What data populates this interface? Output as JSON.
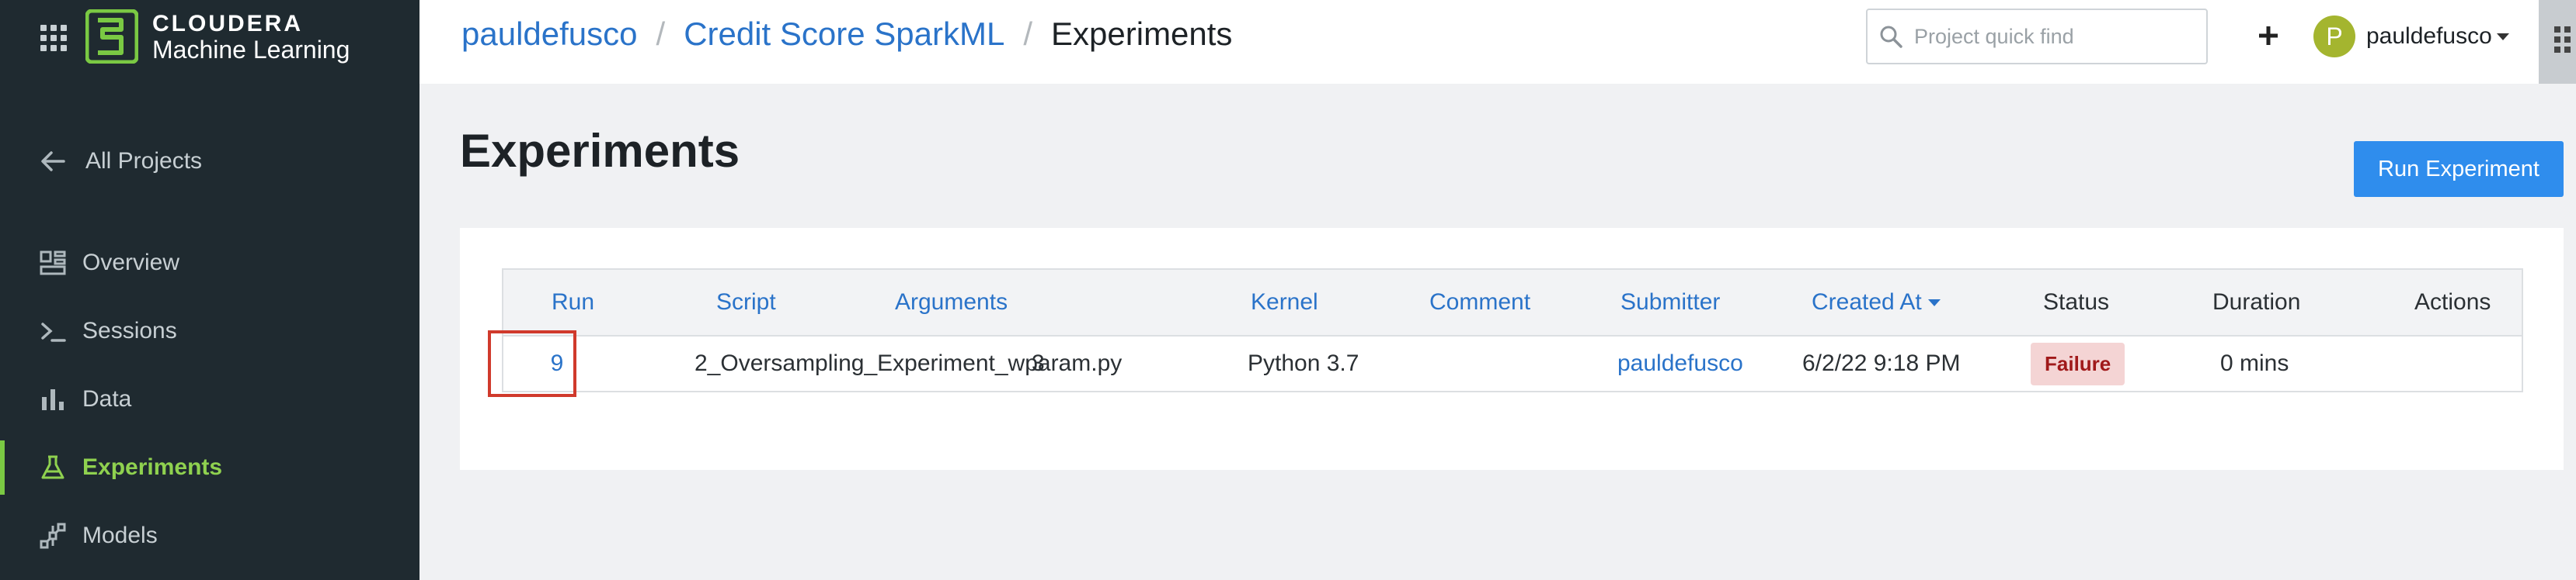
{
  "sidebar": {
    "logo": {
      "brand": "CLOUDERA",
      "product": "Machine Learning"
    },
    "back_link": {
      "label": "All Projects",
      "icon": "arrow-left-icon"
    },
    "items": [
      {
        "label": "Overview",
        "icon": "dashboard-icon",
        "active": false
      },
      {
        "label": "Sessions",
        "icon": "terminal-icon",
        "active": false
      },
      {
        "label": "Data",
        "icon": "bar-chart-icon",
        "active": false
      },
      {
        "label": "Experiments",
        "icon": "flask-icon",
        "active": true
      },
      {
        "label": "Models",
        "icon": "model-graph-icon",
        "active": false
      }
    ]
  },
  "header": {
    "breadcrumb": [
      "pauldefusco",
      "Credit Score SparkML",
      "Experiments"
    ],
    "search": {
      "placeholder": "Project quick find",
      "value": ""
    },
    "user": {
      "initial": "P",
      "name": "pauldefusco"
    }
  },
  "main": {
    "title": "Experiments",
    "run_button": "Run Experiment",
    "table": {
      "columns": [
        "Run",
        "Script",
        "Arguments",
        "Kernel",
        "Comment",
        "Submitter",
        "Created At",
        "Status",
        "Duration",
        "Actions"
      ],
      "rows": [
        {
          "run": "9",
          "script": "2_Oversampling_Experiment_wparam.py",
          "arguments": "3",
          "kernel": "Python 3.7",
          "comment": "",
          "submitter": "pauldefusco",
          "created_at": "6/2/22 9:18 PM",
          "status": "Failure",
          "duration": "0 mins",
          "actions": ""
        }
      ]
    }
  },
  "colors": {
    "sidebar_bg": "#1f2a30",
    "accent_green": "#8fd14f",
    "link_blue": "#2a73c9",
    "primary_button": "#2f8ded",
    "failure_badge_bg": "#f4d4d4",
    "failure_badge_text": "#a0191a",
    "highlight_red": "#d03a2c"
  }
}
